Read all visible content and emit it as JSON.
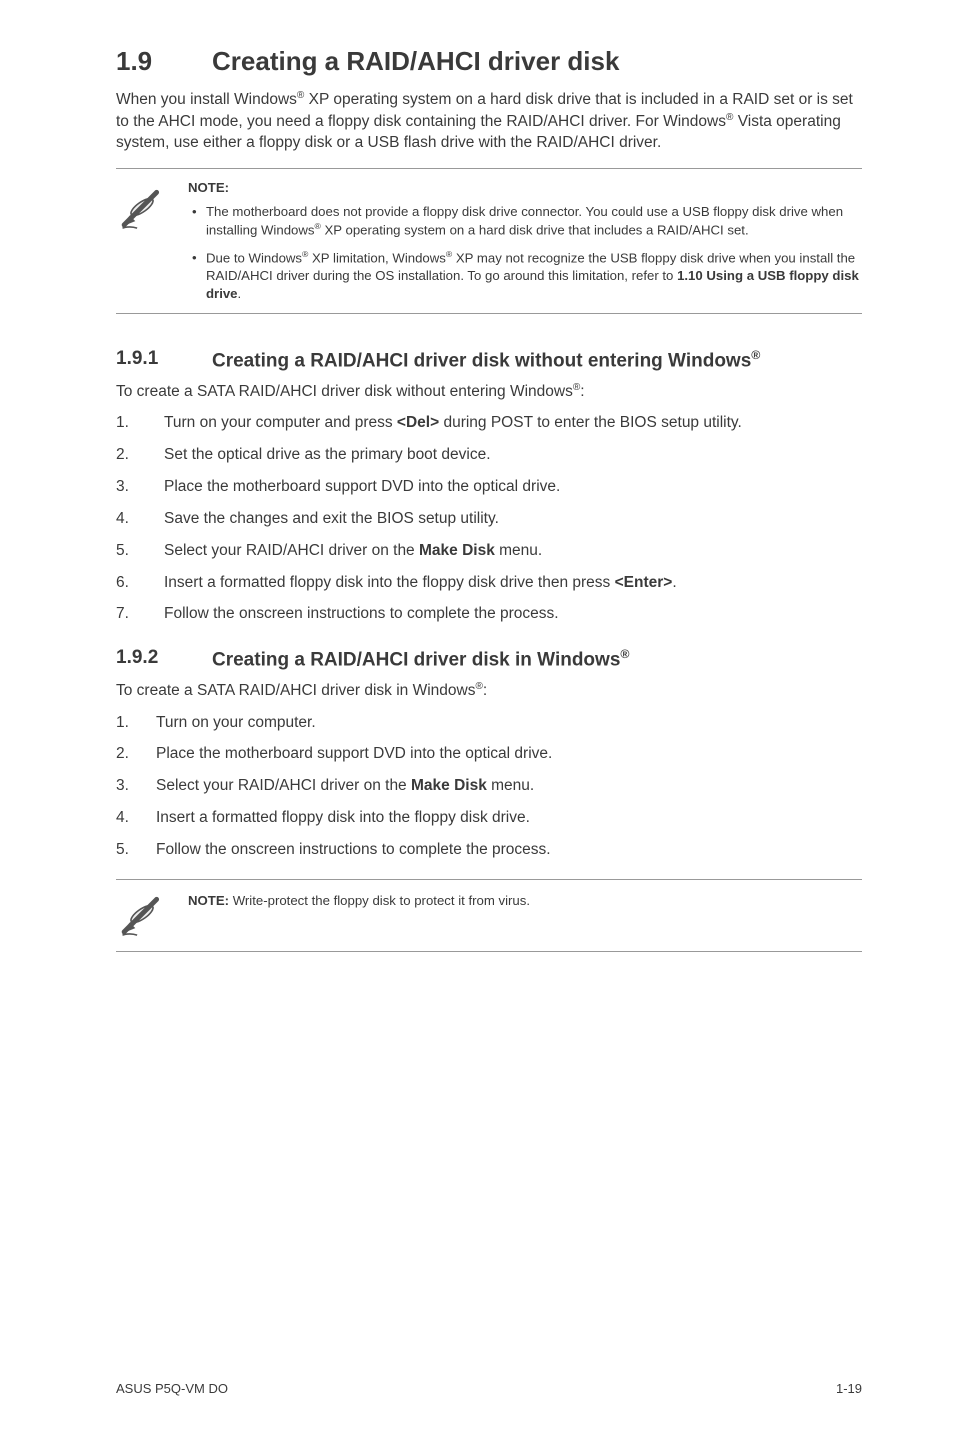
{
  "section": {
    "number": "1.9",
    "title": "Creating a RAID/AHCI driver disk",
    "intro": "When you install Windows® XP operating system on a hard disk drive that is included in a RAID set or is set to the AHCI mode, you need a floppy disk containing the RAID/AHCI driver. For Windows® Vista operating system, use either a floppy disk or a USB flash drive with the RAID/AHCI driver."
  },
  "note1": {
    "head": "NOTE:",
    "bullets": [
      "The motherboard does not provide a floppy disk drive connector. You could use a USB floppy disk drive when installing Windows® XP operating system on a hard disk drive that includes a RAID/AHCI set.",
      "Due to Windows® XP limitation, Windows® XP may not recognize the USB floppy disk drive when you install the RAID/AHCI driver during the OS installation. To go around this limitation, refer to 1.10 Using a USB floppy disk drive."
    ]
  },
  "sub1": {
    "number": "1.9.1",
    "title": "Creating a RAID/AHCI driver disk without entering Windows®",
    "lead": "To create a SATA RAID/AHCI driver disk without entering Windows®:",
    "steps": [
      "Turn on your computer and press <Del> during POST to enter the BIOS setup utility.",
      "Set the optical drive as the primary boot device.",
      "Place the motherboard support DVD into the optical drive.",
      "Save the changes and exit the BIOS setup utility.",
      "Select your RAID/AHCI driver on the Make Disk menu.",
      "Insert a formatted floppy disk into the floppy disk drive then press <Enter>.",
      "Follow the onscreen instructions to complete the process."
    ]
  },
  "sub2": {
    "number": "1.9.2",
    "title": "Creating a RAID/AHCI driver disk in Windows®",
    "lead": "To create a SATA RAID/AHCI driver disk in Windows®:",
    "steps": [
      "Turn on your computer.",
      "Place the motherboard support DVD into the optical drive.",
      "Select your RAID/AHCI driver on the Make Disk menu.",
      "Insert a formatted floppy disk into the floppy disk drive.",
      "Follow the onscreen instructions to complete the process."
    ]
  },
  "note2": {
    "prefix": "NOTE: ",
    "text": "Write-protect the floppy disk to protect it from virus."
  },
  "footer": {
    "left": "ASUS P5Q-VM DO",
    "right": "1-19"
  }
}
